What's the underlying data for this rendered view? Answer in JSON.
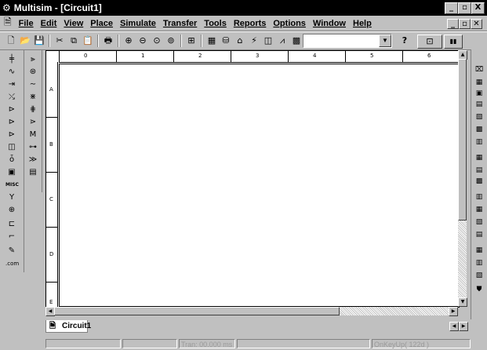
{
  "window": {
    "title": "Multisim - [Circuit1]",
    "controls": [
      "_",
      "И",
      "X"
    ]
  },
  "menu": [
    {
      "label": "File",
      "accel": "F"
    },
    {
      "label": "Edit",
      "accel": "E"
    },
    {
      "label": "View",
      "accel": "V"
    },
    {
      "label": "Place",
      "accel": "P"
    },
    {
      "label": "Simulate",
      "accel": "S"
    },
    {
      "label": "Transfer",
      "accel": "r"
    },
    {
      "label": "Tools",
      "accel": "T"
    },
    {
      "label": "Reports",
      "accel": "R"
    },
    {
      "label": "Options",
      "accel": "O"
    },
    {
      "label": "Window",
      "accel": "W"
    },
    {
      "label": "Help",
      "accel": "H"
    }
  ],
  "toolbar": {
    "icons": [
      "new-icon",
      "open-icon",
      "save-icon",
      "cut-icon",
      "copy-icon",
      "paste-icon",
      "print-icon",
      "zoom-in-icon",
      "zoom-out-icon",
      "zoom-area-icon",
      "zoom-fit-icon",
      "hierarchy-icon",
      "spreadsheet-icon",
      "database-icon",
      "component-wizard-icon",
      "postprocessor-icon",
      "grapher-icon",
      "analysis-icon",
      "instrument-icon"
    ],
    "combo_value": "",
    "help_glyph": "?"
  },
  "ruler": {
    "columns": [
      "0",
      "1",
      "2",
      "3",
      "4",
      "5",
      "6"
    ],
    "rows": [
      "A",
      "B",
      "C",
      "D",
      "E"
    ]
  },
  "tabs": [
    {
      "label": "Circuit1"
    }
  ],
  "status": {
    "panels": [
      "",
      "",
      "Tran: 00.000 ms",
      "",
      "OnKeyUp( 122d )"
    ]
  },
  "colors": {
    "titlebar": "#000000",
    "chrome": "#c0c0c0",
    "sheet": "#ffffff",
    "status_text": "#9a9a9a"
  }
}
